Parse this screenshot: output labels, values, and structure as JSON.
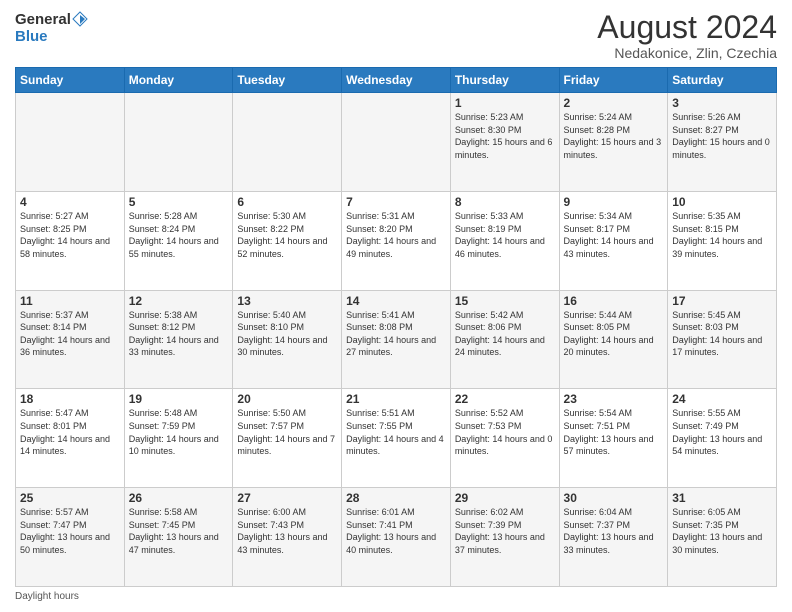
{
  "header": {
    "logo_general": "General",
    "logo_blue": "Blue",
    "title": "August 2024",
    "subtitle": "Nedakonice, Zlin, Czechia"
  },
  "days_of_week": [
    "Sunday",
    "Monday",
    "Tuesday",
    "Wednesday",
    "Thursday",
    "Friday",
    "Saturday"
  ],
  "weeks": [
    [
      {
        "day": "",
        "sunrise": "",
        "sunset": "",
        "daylight": ""
      },
      {
        "day": "",
        "sunrise": "",
        "sunset": "",
        "daylight": ""
      },
      {
        "day": "",
        "sunrise": "",
        "sunset": "",
        "daylight": ""
      },
      {
        "day": "",
        "sunrise": "",
        "sunset": "",
        "daylight": ""
      },
      {
        "day": "1",
        "sunrise": "Sunrise: 5:23 AM",
        "sunset": "Sunset: 8:30 PM",
        "daylight": "Daylight: 15 hours and 6 minutes."
      },
      {
        "day": "2",
        "sunrise": "Sunrise: 5:24 AM",
        "sunset": "Sunset: 8:28 PM",
        "daylight": "Daylight: 15 hours and 3 minutes."
      },
      {
        "day": "3",
        "sunrise": "Sunrise: 5:26 AM",
        "sunset": "Sunset: 8:27 PM",
        "daylight": "Daylight: 15 hours and 0 minutes."
      }
    ],
    [
      {
        "day": "4",
        "sunrise": "Sunrise: 5:27 AM",
        "sunset": "Sunset: 8:25 PM",
        "daylight": "Daylight: 14 hours and 58 minutes."
      },
      {
        "day": "5",
        "sunrise": "Sunrise: 5:28 AM",
        "sunset": "Sunset: 8:24 PM",
        "daylight": "Daylight: 14 hours and 55 minutes."
      },
      {
        "day": "6",
        "sunrise": "Sunrise: 5:30 AM",
        "sunset": "Sunset: 8:22 PM",
        "daylight": "Daylight: 14 hours and 52 minutes."
      },
      {
        "day": "7",
        "sunrise": "Sunrise: 5:31 AM",
        "sunset": "Sunset: 8:20 PM",
        "daylight": "Daylight: 14 hours and 49 minutes."
      },
      {
        "day": "8",
        "sunrise": "Sunrise: 5:33 AM",
        "sunset": "Sunset: 8:19 PM",
        "daylight": "Daylight: 14 hours and 46 minutes."
      },
      {
        "day": "9",
        "sunrise": "Sunrise: 5:34 AM",
        "sunset": "Sunset: 8:17 PM",
        "daylight": "Daylight: 14 hours and 43 minutes."
      },
      {
        "day": "10",
        "sunrise": "Sunrise: 5:35 AM",
        "sunset": "Sunset: 8:15 PM",
        "daylight": "Daylight: 14 hours and 39 minutes."
      }
    ],
    [
      {
        "day": "11",
        "sunrise": "Sunrise: 5:37 AM",
        "sunset": "Sunset: 8:14 PM",
        "daylight": "Daylight: 14 hours and 36 minutes."
      },
      {
        "day": "12",
        "sunrise": "Sunrise: 5:38 AM",
        "sunset": "Sunset: 8:12 PM",
        "daylight": "Daylight: 14 hours and 33 minutes."
      },
      {
        "day": "13",
        "sunrise": "Sunrise: 5:40 AM",
        "sunset": "Sunset: 8:10 PM",
        "daylight": "Daylight: 14 hours and 30 minutes."
      },
      {
        "day": "14",
        "sunrise": "Sunrise: 5:41 AM",
        "sunset": "Sunset: 8:08 PM",
        "daylight": "Daylight: 14 hours and 27 minutes."
      },
      {
        "day": "15",
        "sunrise": "Sunrise: 5:42 AM",
        "sunset": "Sunset: 8:06 PM",
        "daylight": "Daylight: 14 hours and 24 minutes."
      },
      {
        "day": "16",
        "sunrise": "Sunrise: 5:44 AM",
        "sunset": "Sunset: 8:05 PM",
        "daylight": "Daylight: 14 hours and 20 minutes."
      },
      {
        "day": "17",
        "sunrise": "Sunrise: 5:45 AM",
        "sunset": "Sunset: 8:03 PM",
        "daylight": "Daylight: 14 hours and 17 minutes."
      }
    ],
    [
      {
        "day": "18",
        "sunrise": "Sunrise: 5:47 AM",
        "sunset": "Sunset: 8:01 PM",
        "daylight": "Daylight: 14 hours and 14 minutes."
      },
      {
        "day": "19",
        "sunrise": "Sunrise: 5:48 AM",
        "sunset": "Sunset: 7:59 PM",
        "daylight": "Daylight: 14 hours and 10 minutes."
      },
      {
        "day": "20",
        "sunrise": "Sunrise: 5:50 AM",
        "sunset": "Sunset: 7:57 PM",
        "daylight": "Daylight: 14 hours and 7 minutes."
      },
      {
        "day": "21",
        "sunrise": "Sunrise: 5:51 AM",
        "sunset": "Sunset: 7:55 PM",
        "daylight": "Daylight: 14 hours and 4 minutes."
      },
      {
        "day": "22",
        "sunrise": "Sunrise: 5:52 AM",
        "sunset": "Sunset: 7:53 PM",
        "daylight": "Daylight: 14 hours and 0 minutes."
      },
      {
        "day": "23",
        "sunrise": "Sunrise: 5:54 AM",
        "sunset": "Sunset: 7:51 PM",
        "daylight": "Daylight: 13 hours and 57 minutes."
      },
      {
        "day": "24",
        "sunrise": "Sunrise: 5:55 AM",
        "sunset": "Sunset: 7:49 PM",
        "daylight": "Daylight: 13 hours and 54 minutes."
      }
    ],
    [
      {
        "day": "25",
        "sunrise": "Sunrise: 5:57 AM",
        "sunset": "Sunset: 7:47 PM",
        "daylight": "Daylight: 13 hours and 50 minutes."
      },
      {
        "day": "26",
        "sunrise": "Sunrise: 5:58 AM",
        "sunset": "Sunset: 7:45 PM",
        "daylight": "Daylight: 13 hours and 47 minutes."
      },
      {
        "day": "27",
        "sunrise": "Sunrise: 6:00 AM",
        "sunset": "Sunset: 7:43 PM",
        "daylight": "Daylight: 13 hours and 43 minutes."
      },
      {
        "day": "28",
        "sunrise": "Sunrise: 6:01 AM",
        "sunset": "Sunset: 7:41 PM",
        "daylight": "Daylight: 13 hours and 40 minutes."
      },
      {
        "day": "29",
        "sunrise": "Sunrise: 6:02 AM",
        "sunset": "Sunset: 7:39 PM",
        "daylight": "Daylight: 13 hours and 37 minutes."
      },
      {
        "day": "30",
        "sunrise": "Sunrise: 6:04 AM",
        "sunset": "Sunset: 7:37 PM",
        "daylight": "Daylight: 13 hours and 33 minutes."
      },
      {
        "day": "31",
        "sunrise": "Sunrise: 6:05 AM",
        "sunset": "Sunset: 7:35 PM",
        "daylight": "Daylight: 13 hours and 30 minutes."
      }
    ]
  ],
  "daylight_note": "Daylight hours"
}
